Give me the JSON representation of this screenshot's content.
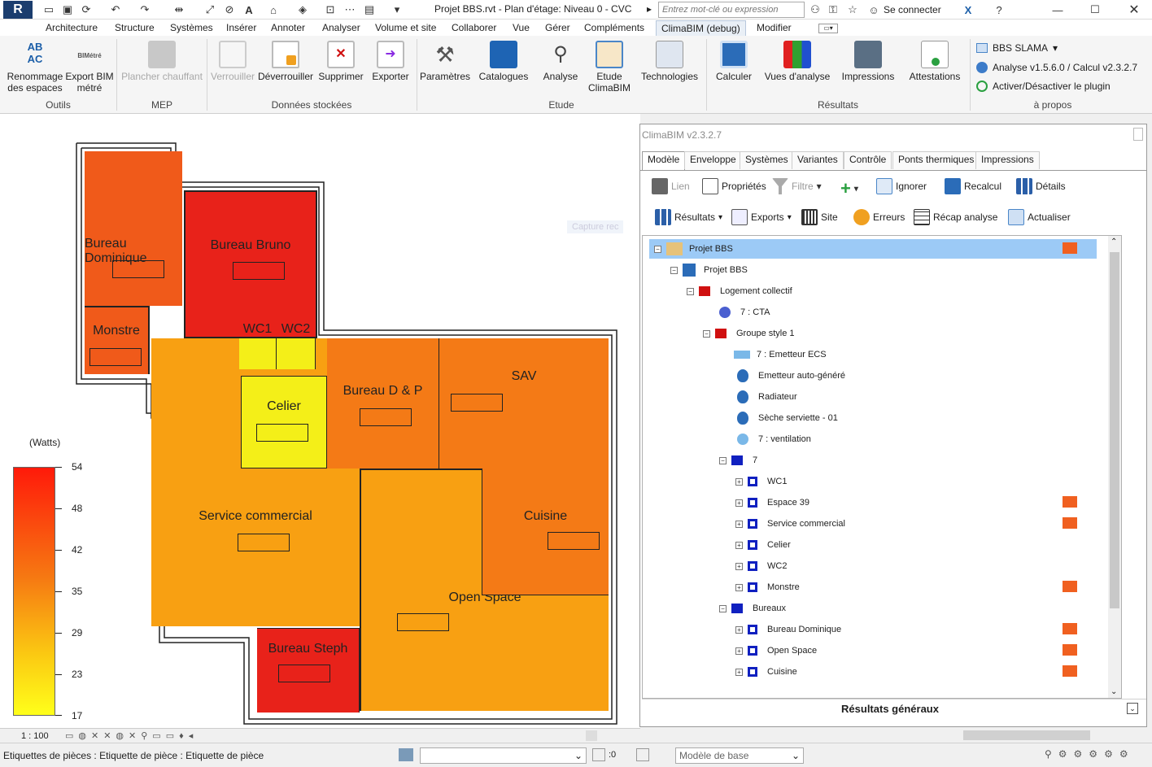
{
  "titlebar": {
    "title": "Projet BBS.rvt - Plan d'étage: Niveau 0 - CVC",
    "search_placeholder": "Entrez mot-clé ou expression",
    "connect_label": "Se connecter"
  },
  "menu_tabs": [
    "Architecture",
    "Structure",
    "Systèmes",
    "Insérer",
    "Annoter",
    "Analyser",
    "Volume et site",
    "Collaborer",
    "Vue",
    "Gérer",
    "Compléments",
    "ClimaBIM (debug)",
    "Modifier"
  ],
  "ribbon": {
    "outils": {
      "label": "Outils",
      "btn1": "Renommage des espaces",
      "btn2": "Export BIM métré",
      "icon_text": "AB AC",
      "icon_text2": "BIMétré"
    },
    "mep": {
      "label": "MEP",
      "btn1": "Plancher chauffant"
    },
    "donnees": {
      "label": "Données stockées",
      "btn1": "Verrouiller",
      "btn2": "Déverrouiller",
      "btn3": "Supprimer",
      "btn4": "Exporter"
    },
    "etude": {
      "label": "Etude",
      "btn1": "Paramètres",
      "btn2": "Catalogues",
      "btn3": "Analyse",
      "btn4": "Etude ClimaBIM",
      "btn5": "Technologies"
    },
    "resultats": {
      "label": "Résultats",
      "btn1": "Calculer",
      "btn2": "Vues d'analyse",
      "btn3": "Impressions",
      "btn4": "Attestations"
    },
    "apropos": {
      "label": "à propos",
      "line1": "BBS SLAMA",
      "line2": "Analyse v1.5.6.0 / Calcul v2.3.2.7",
      "line3": "Activer/Désactiver le plugin"
    }
  },
  "plan": {
    "rooms": [
      "Bureau Dominique",
      "Bureau Bruno",
      "Monstre",
      "WC1",
      "WC2",
      "Celier",
      "Bureau D & P",
      "SAV",
      "Service commercial",
      "Cuisine",
      "Open Space",
      "Bureau Steph"
    ],
    "colors": {
      "hot": "#e8221a",
      "warm": "#f05a1a",
      "mid": "#f47a16",
      "orange": "#f8a012",
      "yellow": "#f4ef18"
    },
    "legend_unit": "(Watts)",
    "legend_values": [
      "54",
      "48",
      "42",
      "35",
      "29",
      "23",
      "17"
    ],
    "scale": "1 : 100"
  },
  "panel": {
    "title": "ClimaBIM v2.3.2.7",
    "tabs": [
      "Modèle",
      "Enveloppe",
      "Systèmes",
      "Variantes",
      "Contrôle",
      "Ponts thermiques",
      "Impressions"
    ],
    "toolbar1": {
      "lien": "Lien",
      "proprietes": "Propriétés",
      "filtre": "Filtre",
      "ignorer": "Ignorer",
      "recalcul": "Recalcul",
      "details": "Détails"
    },
    "toolbar2": {
      "resultats": "Résultats",
      "exports": "Exports",
      "site": "Site",
      "erreurs": "Erreurs",
      "recap": "Récap analyse",
      "actualiser": "Actualiser"
    },
    "ghost_text": "Capture rec",
    "tree": [
      "Projet BBS",
      "Projet BBS",
      "Logement collectif",
      "7 : CTA",
      "Groupe style 1",
      "7 : Emetteur ECS",
      "Emetteur auto-généré",
      "Radiateur",
      "Sèche serviette - 01",
      "7 : ventilation",
      "7",
      "WC1",
      "Espace 39",
      "Service commercial",
      "Celier",
      "WC2",
      "Monstre",
      "Bureaux",
      "Bureau Dominique",
      "Open Space",
      "Cuisine"
    ],
    "footer": "Résultats généraux"
  },
  "status": {
    "text": "Etiquettes de pièces : Etiquette de pièce : Etiquette de pièce",
    "zero": ":0",
    "model": "Modèle de base"
  }
}
